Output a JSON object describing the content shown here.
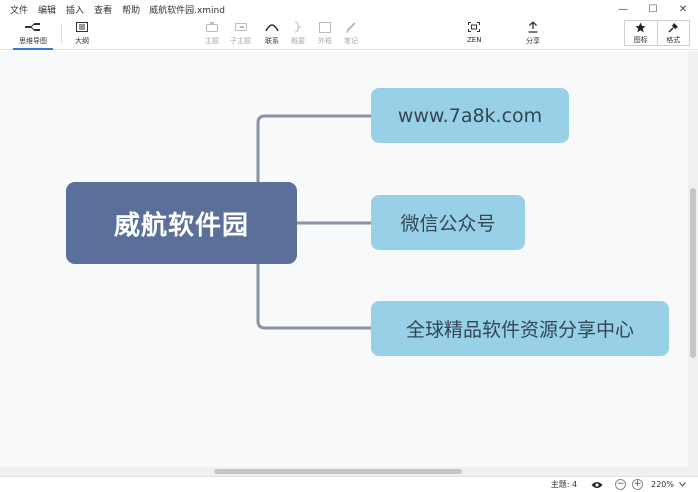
{
  "menu": {
    "items": [
      "文件",
      "编辑",
      "插入",
      "查看",
      "帮助"
    ],
    "filename": "威航软件园.xmind"
  },
  "window": {
    "minimize": "—",
    "maximize": "☐",
    "close": "✕"
  },
  "toolbar": {
    "mindmap": "思维导图",
    "outline": "大纲",
    "topic": "主题",
    "subtopic": "子主题",
    "relationship": "联系",
    "summary": "概要",
    "boundary": "外框",
    "notes": "笔记",
    "zen": "ZEN",
    "share": "分享",
    "icons": "图标",
    "format": "格式"
  },
  "map": {
    "central": "威航软件园",
    "topics": [
      "www.7a8k.com",
      "微信公众号",
      "全球精品软件资源分享中心"
    ]
  },
  "status": {
    "topic_count": "主题: 4",
    "zoom": "220%",
    "zoom_out": "−",
    "zoom_in": "+"
  },
  "colors": {
    "central_fill": "#5a6f99",
    "topic_fill": "#98d0e8",
    "connector": "#8a93a6",
    "accent": "#2b7cd3"
  }
}
